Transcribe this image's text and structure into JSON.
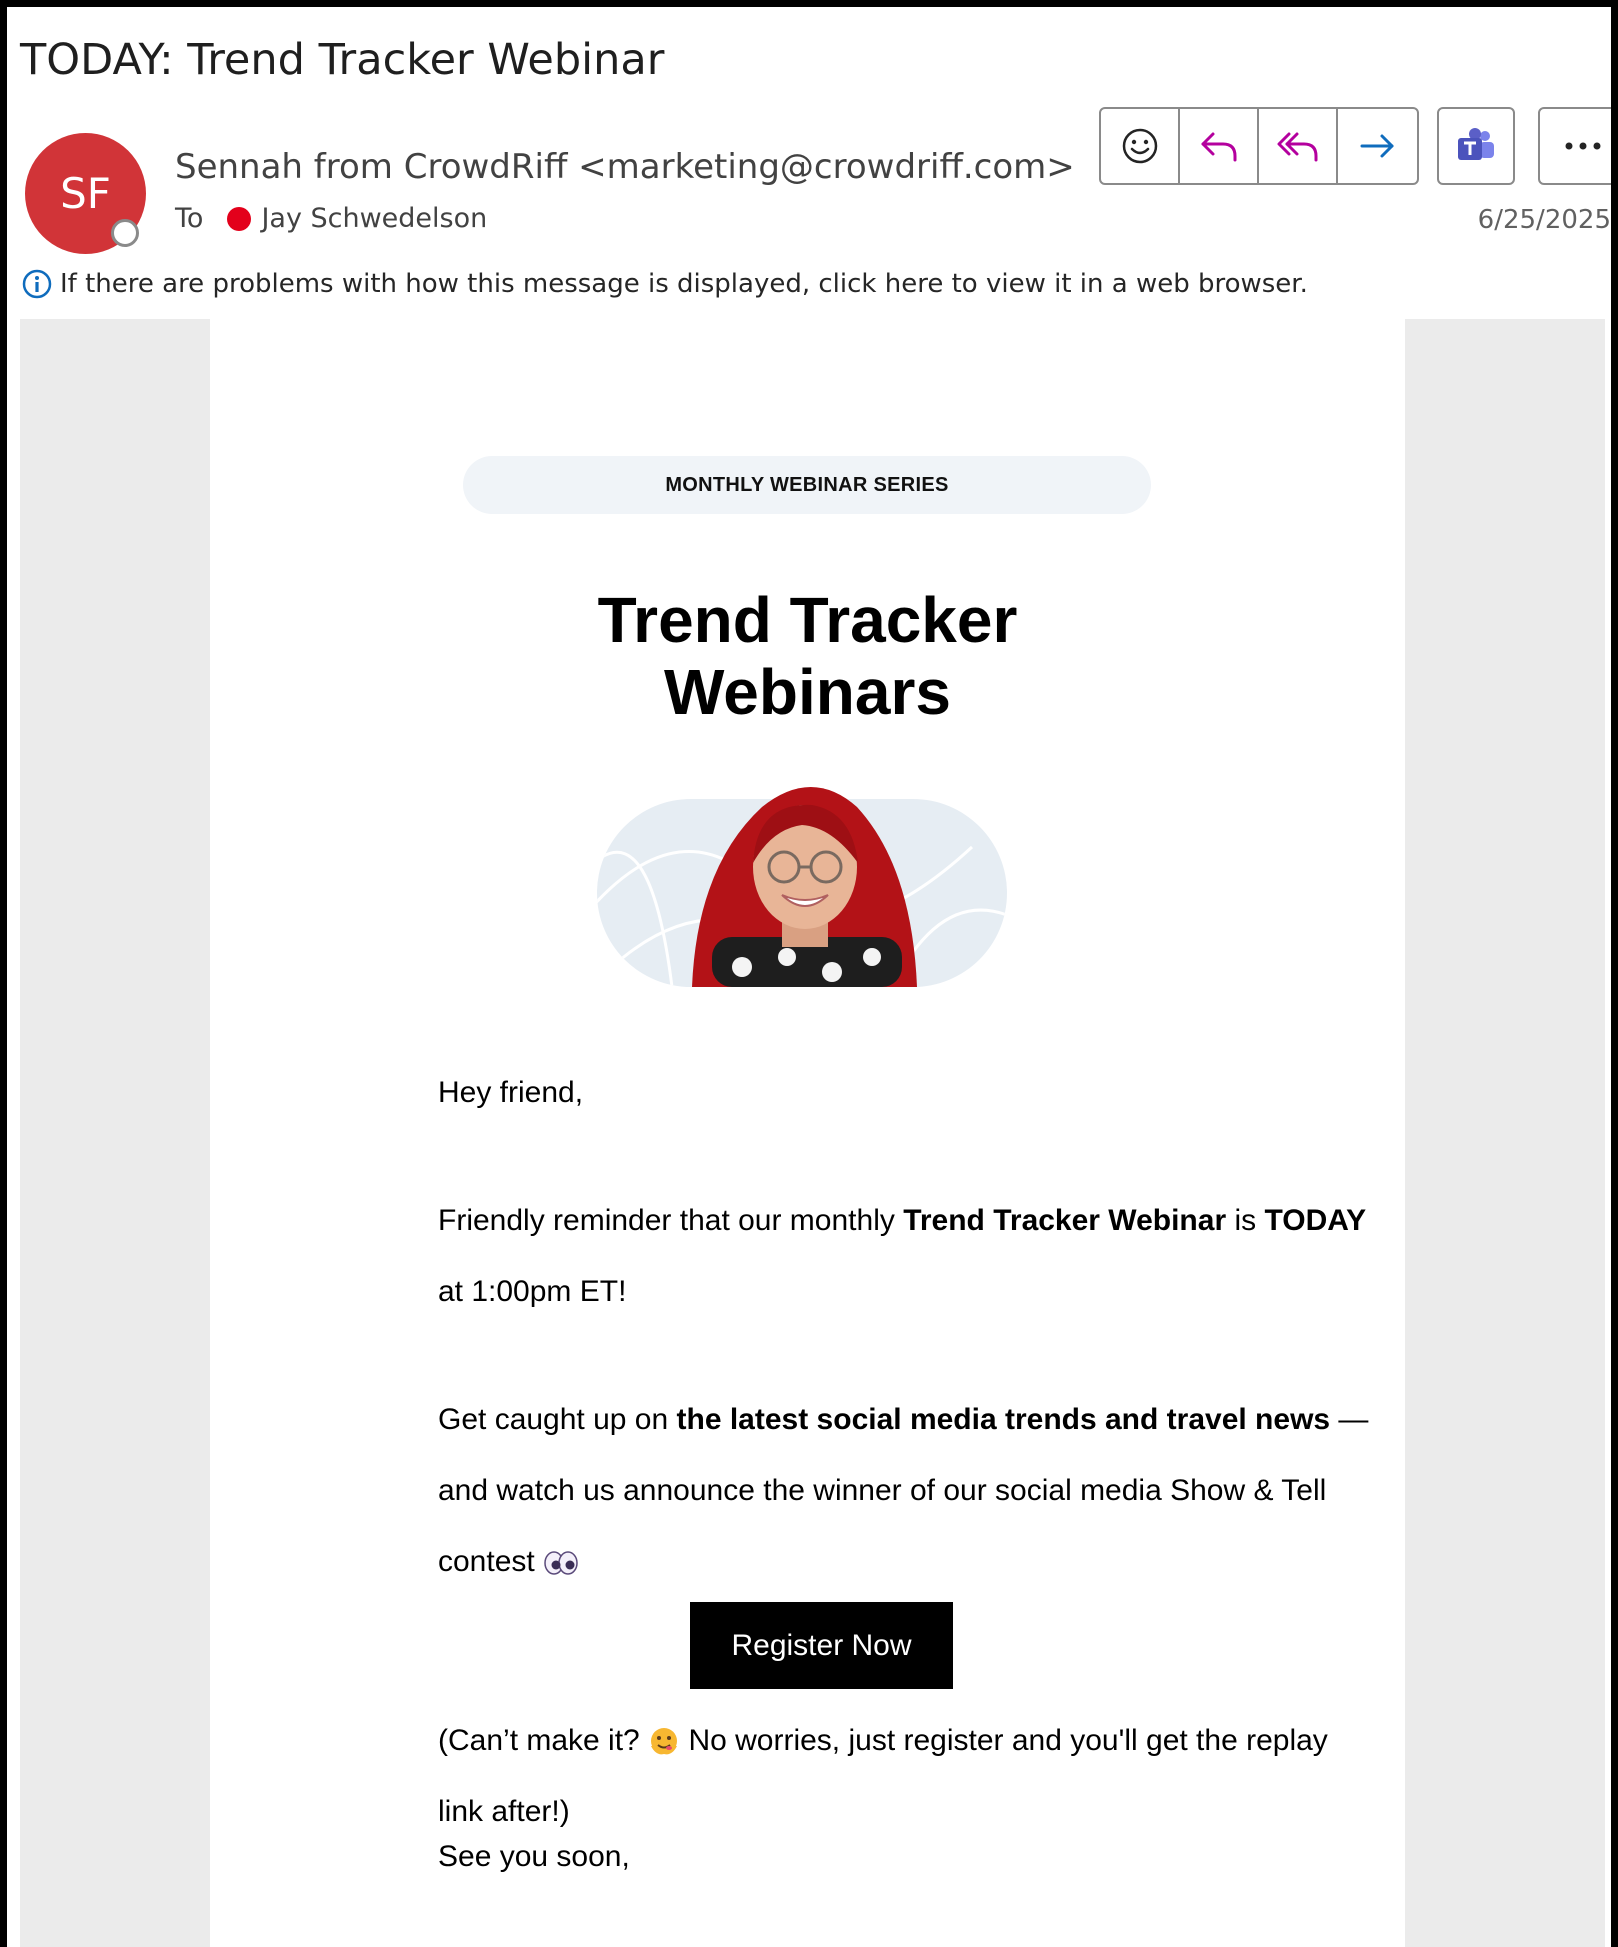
{
  "email": {
    "subject": "TODAY: Trend Tracker Webinar",
    "avatar_initials": "SF",
    "sender": "Sennah from CrowdRiff <marketing@crowdriff.com>",
    "to_label": "To",
    "recipient": "Jay Schwedelson",
    "date": "6/25/2025",
    "info_notice": "If there are problems with how this message is displayed, click here to view it in a web browser."
  },
  "actions": {
    "icons": [
      "emoji-icon",
      "reply-icon",
      "reply-all-icon",
      "forward-icon",
      "teams-icon",
      "more-icon"
    ]
  },
  "body": {
    "pill": "MONTHLY WEBINAR SERIES",
    "headline_line1": "Trend Tracker",
    "headline_line2": "Webinars",
    "greeting": "Hey friend,",
    "reminder_pre": "Friendly reminder that our monthly ",
    "reminder_bold1": "Trend Tracker Webinar",
    "reminder_mid": " is ",
    "reminder_bold2": "TODAY",
    "reminder_post": " at 1:00pm ET!",
    "catchup_pre": "Get caught up on ",
    "catchup_bold": "the latest social media trends and travel news",
    "catchup_post": " — and watch us announce the winner of our social media Show & Tell contest",
    "register_label": "Register Now",
    "cant_pre": "(Can’t make it?",
    "cant_post": "No worries, just register and you'll get the replay link after!)",
    "signoff": "See you soon,"
  },
  "colors": {
    "avatar": "#d13438",
    "accent": "#0f6cbd",
    "reply_purple": "#b4009e",
    "presence_busy": "#e3001b",
    "teams": "#5b5fc7"
  }
}
